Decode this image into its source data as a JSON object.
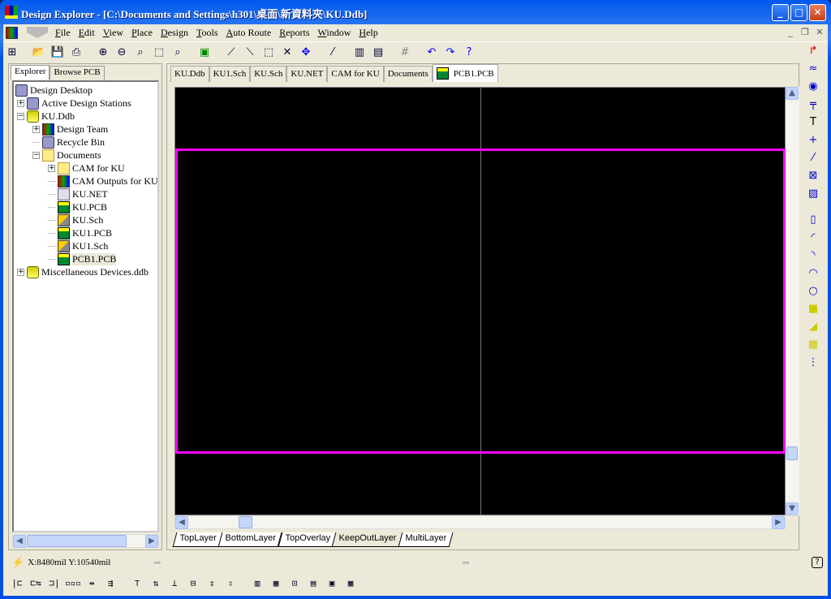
{
  "window": {
    "title": "Design Explorer - [C:\\Documents and Settings\\h301\\桌面\\新資料夾\\KU.Ddb]",
    "minimize": "_",
    "maximize": "□",
    "close": "✕"
  },
  "menu": [
    "File",
    "Edit",
    "View",
    "Place",
    "Design",
    "Tools",
    "Auto Route",
    "Reports",
    "Window",
    "Help"
  ],
  "toolbar": {
    "icons": [
      "explorer-toggle-icon",
      "open-icon",
      "save-icon",
      "print-icon",
      "zoom-in-icon",
      "zoom-out-icon",
      "zoom-fit-icon",
      "zoom-area-icon",
      "zoom-selected-icon",
      "component-icon",
      "cross-probe-icon",
      "route-icon",
      "select-area-icon",
      "deselect-icon",
      "move-icon",
      "magic-wand-icon",
      "library-icon",
      "browse-library-icon",
      "grid-icon",
      "undo-icon",
      "redo-icon",
      "help-icon"
    ]
  },
  "left_panel": {
    "tabs": [
      "Explorer",
      "Browse PCB"
    ],
    "active_tab": "Explorer",
    "tree": [
      {
        "label": "Design Desktop",
        "level": 0,
        "icon": "desktop",
        "expander": ""
      },
      {
        "label": "Active Design Stations",
        "level": 1,
        "icon": "pc",
        "expander": "+"
      },
      {
        "label": "KU.Ddb",
        "level": 1,
        "icon": "db",
        "expander": "−"
      },
      {
        "label": "Design Team",
        "level": 2,
        "icon": "misc",
        "expander": "+"
      },
      {
        "label": "Recycle Bin",
        "level": 2,
        "icon": "pc",
        "expander": ""
      },
      {
        "label": "Documents",
        "level": 2,
        "icon": "fold",
        "expander": "−"
      },
      {
        "label": "CAM for KU",
        "level": 3,
        "icon": "fold",
        "expander": "+"
      },
      {
        "label": "CAM Outputs for KU",
        "level": 3,
        "icon": "misc",
        "expander": ""
      },
      {
        "label": "KU.NET",
        "level": 3,
        "icon": "net",
        "expander": ""
      },
      {
        "label": "KU.PCB",
        "level": 3,
        "icon": "pcb",
        "expander": ""
      },
      {
        "label": "KU.Sch",
        "level": 3,
        "icon": "sch",
        "expander": ""
      },
      {
        "label": "KU1.PCB",
        "level": 3,
        "icon": "pcb",
        "expander": ""
      },
      {
        "label": "KU1.Sch",
        "level": 3,
        "icon": "sch",
        "expander": ""
      },
      {
        "label": "PCB1.PCB",
        "level": 3,
        "icon": "pcb",
        "expander": "",
        "selected": true
      },
      {
        "label": "Miscellaneous Devices.ddb",
        "level": 1,
        "icon": "db",
        "expander": "+"
      }
    ]
  },
  "doc_tabs": [
    "KU.Ddb",
    "KU1.Sch",
    "KU.Sch",
    "KU.NET",
    "CAM for KU",
    "Documents",
    "PCB1.PCB"
  ],
  "active_doc_tab": "PCB1.PCB",
  "layer_tabs": [
    "TopLayer",
    "BottomLayer",
    "TopOverlay",
    "KeepOutLayer",
    "MultiLayer"
  ],
  "active_layer": "KeepOutLayer",
  "colors": {
    "board_outline": "#ff00ff",
    "canvas": "#000000",
    "title_bar": "#0054e3"
  },
  "status": {
    "coords": "X:8480mil Y:10540mil"
  },
  "right_toolbar": [
    "place-track-icon",
    "interactive-route-icon",
    "via-icon",
    "pad-icon",
    "string-icon",
    "coordinate-icon",
    "dimension-icon",
    "origin-icon",
    "fill-hatch-icon",
    "component-place-icon",
    "arc-center-icon",
    "arc-edge-icon",
    "arc-any-icon",
    "circle-icon",
    "fill-icon",
    "polygon-plane-icon",
    "split-plane-icon",
    "array-paste-icon"
  ],
  "right_toolbar_glyphs": [
    "↱",
    "≈",
    "◉",
    "╤",
    "T",
    "+",
    "⁄",
    "⊠",
    "▨",
    "▯",
    "◜",
    "◝",
    "◠",
    "○",
    "■",
    "◢",
    "▦",
    "⋮"
  ],
  "bottom_toolbar": [
    "align-left-icon",
    "align-left-space-icon",
    "align-right-icon",
    "horiz-space-equal-icon",
    "horiz-space-increase-icon",
    "horiz-space-decrease-icon",
    "align-top-icon",
    "align-top-space-icon",
    "align-bottom-icon",
    "align-center-icon",
    "vert-space-increase-icon",
    "vert-space-decrease-icon",
    "group-icon",
    "ungroup-icon",
    "align-grid-icon",
    "room-icon",
    "move-to-room-icon",
    "component-report-icon"
  ]
}
